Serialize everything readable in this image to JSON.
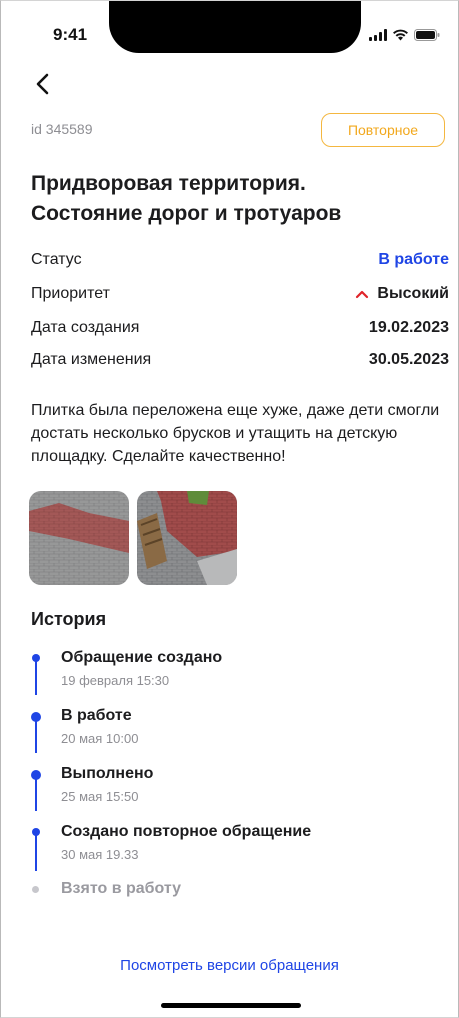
{
  "status_bar": {
    "time": "9:41"
  },
  "header": {
    "back_icon": "chevron-left-icon",
    "id_text": "id 345589",
    "badge_label": "Повторное",
    "badge_color": "#f2a81d"
  },
  "ticket": {
    "title_line1": "Придворовая территория.",
    "title_line2": "Состояние дорог и тротуаров",
    "fields": [
      {
        "label": "Статус",
        "value": "В работе"
      },
      {
        "label": "Приоритет",
        "value": "Высокий",
        "icon": "chevron-up-icon"
      },
      {
        "label": "Дата создания",
        "value": "19.02.2023"
      },
      {
        "label": "Дата изменения",
        "value": "30.05.2023"
      }
    ],
    "description": "Плитка была переложена еще хуже, даже дети смогли достать несколько брусков и утащить на детскую площадку. Сделайте качественно!",
    "photos": [
      "paving-photo-1",
      "paving-photo-2"
    ]
  },
  "history": {
    "title": "История",
    "items": [
      {
        "title": "Обращение создано",
        "time": "19 февраля 15:30",
        "done": true
      },
      {
        "title": "В работе",
        "time": "20 мая 10:00",
        "done": true
      },
      {
        "title": "Выполнено",
        "time": "25 мая 15:50",
        "done": true
      },
      {
        "title": "Создано повторное обращение",
        "time": "30 мая 19.33",
        "done": true
      },
      {
        "title": "Взято в работу",
        "time": "",
        "done": false
      }
    ]
  },
  "footer": {
    "versions_link": "Посмотреть  версии обращения"
  },
  "colors": {
    "accent_blue": "#1f45e5",
    "priority_red": "#e0242a",
    "muted_gray": "#8e8e93"
  }
}
